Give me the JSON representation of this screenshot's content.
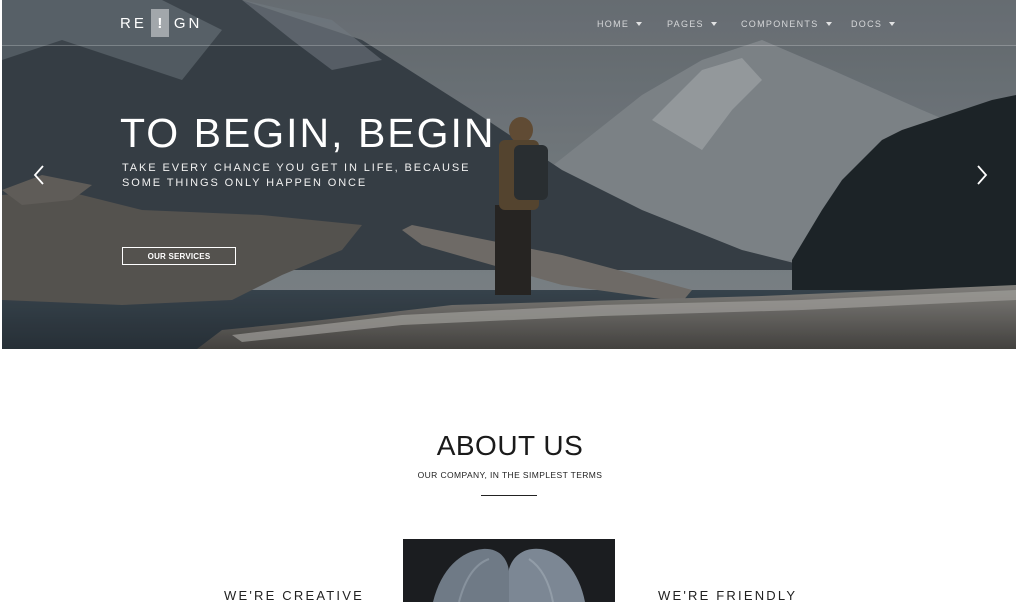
{
  "brand": {
    "part1": "RE",
    "mark": "!",
    "part2": "GN"
  },
  "nav": {
    "items": [
      {
        "label": "HOME"
      },
      {
        "label": "PAGES"
      },
      {
        "label": "COMPONENTS"
      },
      {
        "label": "DOCS"
      }
    ]
  },
  "hero": {
    "title": "TO BEGIN, BEGIN",
    "subtitle_line1": "TAKE EVERY CHANCE YOU GET IN LIFE, BECAUSE",
    "subtitle_line2": "SOME THINGS ONLY HAPPEN ONCE",
    "button_label": "OUR SERVICES"
  },
  "about": {
    "title": "ABOUT US",
    "subtitle": "OUR COMPANY, IN THE SIMPLEST TERMS",
    "features": [
      {
        "title": "WE'RE CREATIVE"
      },
      {
        "title": "WE'RE FRIENDLY"
      }
    ]
  },
  "colors": {
    "overlay_text": "#ffffff",
    "body_text": "#1a1a1a",
    "background": "#ffffff"
  }
}
